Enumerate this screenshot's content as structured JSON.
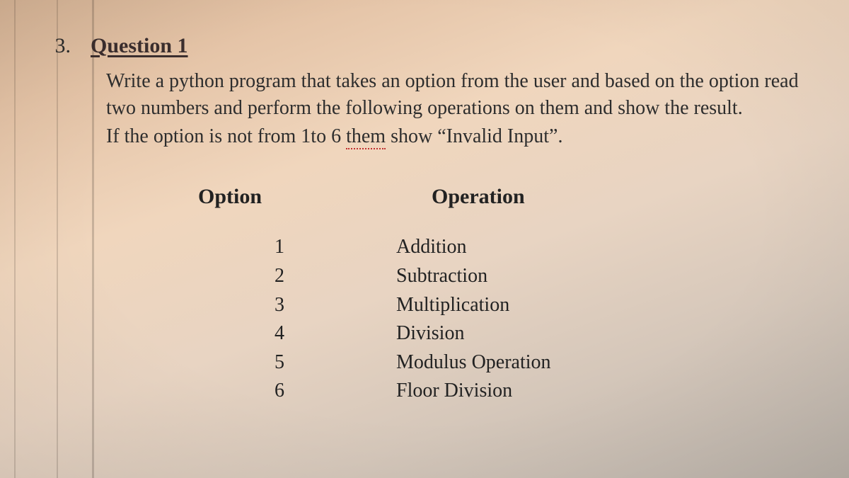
{
  "question_number": "3.",
  "title": "Question 1",
  "instruction_line1": "Write a python program that takes an option from the user and based on the option read two numbers and perform the following operations on them and show the result.",
  "instruction_line2_pre": "If the option is not from 1to 6 ",
  "instruction_line2_squiggle": "them",
  "instruction_line2_post": " show “Invalid Input”.",
  "headers": {
    "option": "Option",
    "operation": "Operation"
  },
  "rows": [
    {
      "option": "1",
      "operation": "Addition"
    },
    {
      "option": "2",
      "operation": "Subtraction"
    },
    {
      "option": "3",
      "operation": "Multiplication"
    },
    {
      "option": "4",
      "operation": "Division"
    },
    {
      "option": "5",
      "operation": "Modulus Operation"
    },
    {
      "option": "6",
      "operation": "Floor Division"
    }
  ]
}
